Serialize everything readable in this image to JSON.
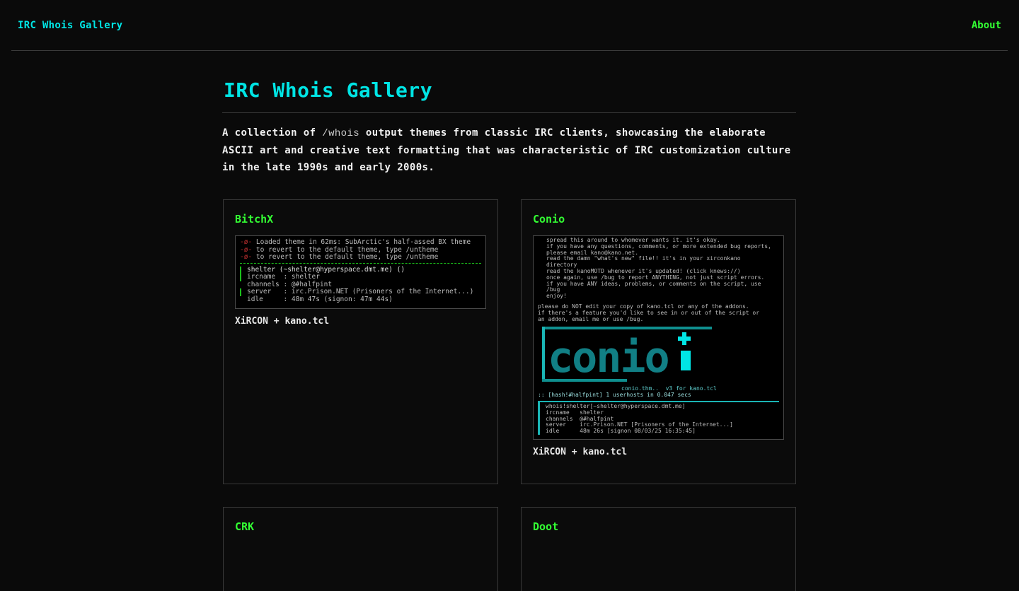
{
  "nav": {
    "brand": "IRC Whois Gallery",
    "about": "About"
  },
  "page": {
    "title": "IRC Whois Gallery",
    "intro_before": "A collection of ",
    "intro_code": "/whois",
    "intro_after": " output themes from classic IRC clients, showcasing the elaborate ASCII art and creative text formatting that was characteristic of IRC customization culture in the late 1990s and early 2000s."
  },
  "cards": [
    {
      "title": "BitchX",
      "caption": "XiRCON + kano.tcl",
      "shot_lines": [
        "Loaded theme in 62ms: SubArctic's half-assed BX theme",
        "to revert to the default theme, type /untheme",
        "to revert to the default theme, type /untheme",
        "shelter (~shelter@hyperspace.dmt.me) ()",
        "ircname  : shelter",
        "channels : @#halfpint",
        "server   : irc.Prison.NET (Prisoners of the Internet...)",
        "idle     : 48m 47s (signon: 47m 44s)"
      ]
    },
    {
      "title": "Conio",
      "caption": "XiRCON + kano.tcl",
      "shot_lines": [
        "spread this around to whomever wants it. it's okay.",
        "if you have any questions, comments, or more extended bug reports,",
        "please email kano@kano.net.",
        "read the damn \"what's new\" file!! it's in your xirconkano",
        "directory",
        "read the kanoMOTD whenever it's updated! (click knews://)",
        "once again, use /bug to report ANYTHING, not just script errors.",
        "if you have ANY ideas, problems, or comments on the script, use",
        "/bug",
        "enjoy!",
        "please do NOT edit your copy of kano.tcl or any of the addons.",
        "if there's a feature you'd like to see in or out of the script or",
        "an addon, email me or use /bug.",
        "conio.thm..  v3 for kano.tcl",
        ":: [hash!#halfpint] 1 userhosts in 0.047 secs",
        "whois!shelter[~shelter@hyperspace.dmt.me]",
        "ircname   shelter",
        "channels  @#halfpint",
        "server    irc.Prison.NET [Prisoners of the Internet...]",
        "idle      48m 26s [signon 08/03/25 16:35:45]"
      ],
      "logo_text": "conio"
    },
    {
      "title": "CRK"
    },
    {
      "title": "Doot"
    }
  ],
  "colors": {
    "background": "#0a0a0a",
    "cyan_accent": "#00e5e5",
    "green_accent": "#33ff33",
    "border": "#3a3a3a"
  }
}
